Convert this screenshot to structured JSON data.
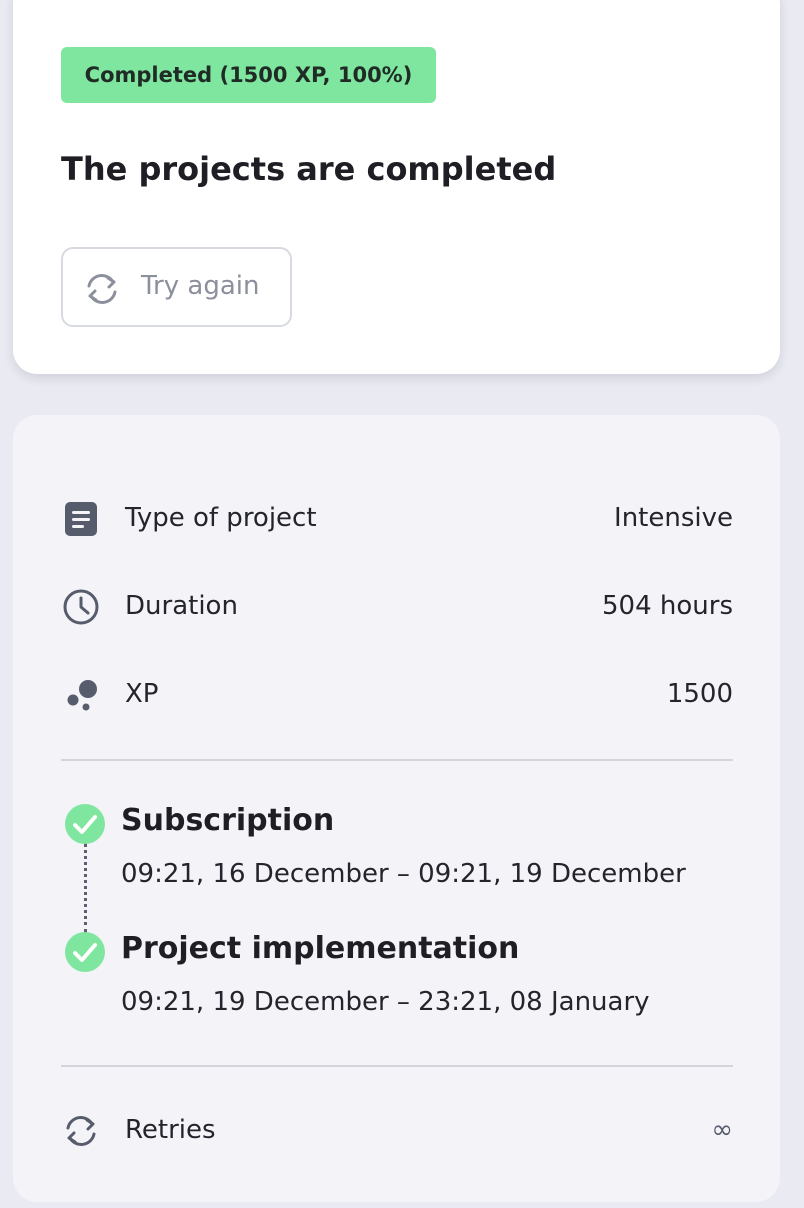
{
  "status": {
    "badge": "Completed (1500 XP, 100%)",
    "badge_color": "#7fe6a0",
    "title": "The projects are completed",
    "retry_button": {
      "label": "Try again",
      "icon": "refresh-icon"
    }
  },
  "details": {
    "rows": [
      {
        "icon": "document-icon",
        "label": "Type of project",
        "value": "Intensive"
      },
      {
        "icon": "clock-icon",
        "label": "Duration",
        "value": "504 hours"
      },
      {
        "icon": "xp-dots-icon",
        "label": "XP",
        "value": "1500"
      }
    ],
    "timeline": [
      {
        "icon": "check-circle-icon",
        "title": "Subscription",
        "dates": "09:21, 16 December – 09:21, 19 December"
      },
      {
        "icon": "check-circle-icon",
        "title": "Project implementation",
        "dates": "09:21, 19 December – 23:21, 08 January"
      }
    ],
    "retries": {
      "icon": "refresh-icon",
      "label": "Retries",
      "value": "∞"
    }
  },
  "colors": {
    "success": "#7fe6a0",
    "icon": "#565c6c",
    "background": "#e9eaf2"
  }
}
